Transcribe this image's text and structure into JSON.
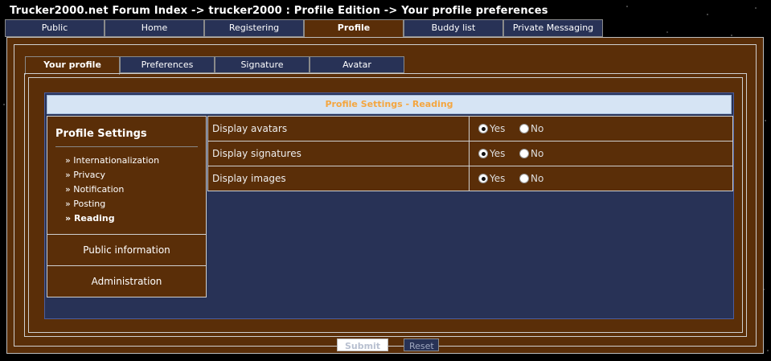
{
  "breadcrumb": "Trucker2000.net Forum Index  -> trucker2000 : Profile Edition  -> Your profile preferences",
  "top_tabs": [
    "Public",
    "Home",
    "Registering",
    "Profile",
    "Buddy list",
    "Private Messaging"
  ],
  "sub_tabs": [
    "Your profile",
    "Preferences",
    "Signature",
    "Avatar"
  ],
  "panel_title": "Profile Settings - Reading",
  "sidebar": {
    "title": "Profile Settings",
    "items": [
      "Internationalization",
      "Privacy",
      "Notification",
      "Posting",
      "Reading"
    ],
    "sections": [
      "Public information",
      "Administration"
    ]
  },
  "settings": [
    {
      "label": "Display avatars",
      "selected": "Yes"
    },
    {
      "label": "Display signatures",
      "selected": "Yes"
    },
    {
      "label": "Display images",
      "selected": "Yes"
    }
  ],
  "option_labels": {
    "yes": "Yes",
    "no": "No"
  },
  "buttons": {
    "submit": "Submit",
    "reset": "Reset"
  },
  "colors": {
    "brown": "#5a2e08",
    "navy": "#283256",
    "header_text": "#f4a640"
  }
}
